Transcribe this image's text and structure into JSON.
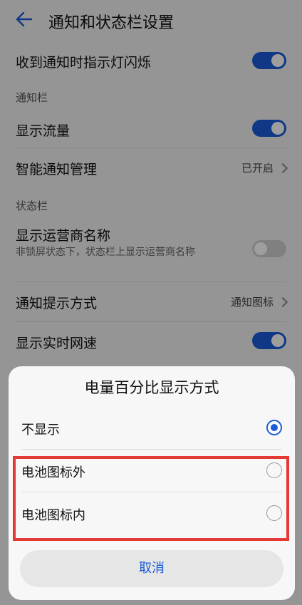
{
  "header": {
    "title": "通知和状态栏设置",
    "back_icon": "back-arrow-icon"
  },
  "rows": {
    "notify_led": {
      "label": "收到通知时指示灯闪烁",
      "toggle": true
    },
    "section_notification_bar": "通知栏",
    "show_traffic": {
      "label": "显示流量",
      "toggle": true
    },
    "smart_notification": {
      "label": "智能通知管理",
      "value": "已开启"
    },
    "section_status_bar": "状态栏",
    "carrier_name": {
      "label": "显示运营商名称",
      "description": "非锁屏状态下，状态栏上显示运营商名称",
      "toggle": false
    },
    "notify_style": {
      "label": "通知提示方式",
      "value": "通知图标"
    },
    "realtime_speed": {
      "label": "显示实时网速",
      "toggle": true
    }
  },
  "dialog": {
    "title": "电量百分比显示方式",
    "options": [
      {
        "label": "不显示",
        "selected": true
      },
      {
        "label": "电池图标外",
        "selected": false
      },
      {
        "label": "电池图标内",
        "selected": false
      }
    ],
    "cancel_label": "取消"
  },
  "colors": {
    "accent": "#1c5bd9",
    "highlight": "#e53935"
  }
}
